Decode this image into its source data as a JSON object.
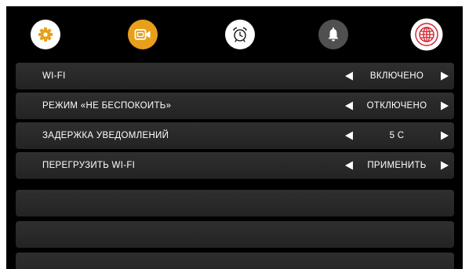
{
  "tabs": [
    {
      "name": "settings-gear",
      "icon": "gear-icon",
      "bg": "#ffffff",
      "fg": "#e8a01b",
      "selected": false
    },
    {
      "name": "video",
      "icon": "video-camera-icon",
      "bg": "#e8a01b",
      "fg": "#ffffff",
      "selected": false
    },
    {
      "name": "alarm-clock",
      "icon": "alarm-clock-icon",
      "bg": "#ffffff",
      "fg": "#000000",
      "selected": false
    },
    {
      "name": "notifications",
      "icon": "bell-icon",
      "bg": "#505050",
      "fg": "#ffffff",
      "selected": false
    },
    {
      "name": "network",
      "icon": "globe-icon",
      "bg": "#ffffff",
      "fg": "#d4202a",
      "selected": true
    }
  ],
  "settings": [
    {
      "label": "WI-FI",
      "value": "ВКЛЮЧЕНО"
    },
    {
      "label": "РЕЖИМ «НЕ БЕСПОКОИТЬ»",
      "value": "ОТКЛЮЧЕНО"
    },
    {
      "label": "ЗАДЕРЖКА УВЕДОМЛЕНИЙ",
      "value": "5 С"
    },
    {
      "label": "ПЕРЕГРУЗИТЬ WI-FI",
      "value": "ПРИМЕНИТЬ"
    }
  ],
  "empty_rows": 3,
  "colors": {
    "background": "#000000",
    "row": "#2a2a2a",
    "text": "#ffffff",
    "accent_orange": "#e8a01b",
    "accent_red": "#d4202a"
  }
}
